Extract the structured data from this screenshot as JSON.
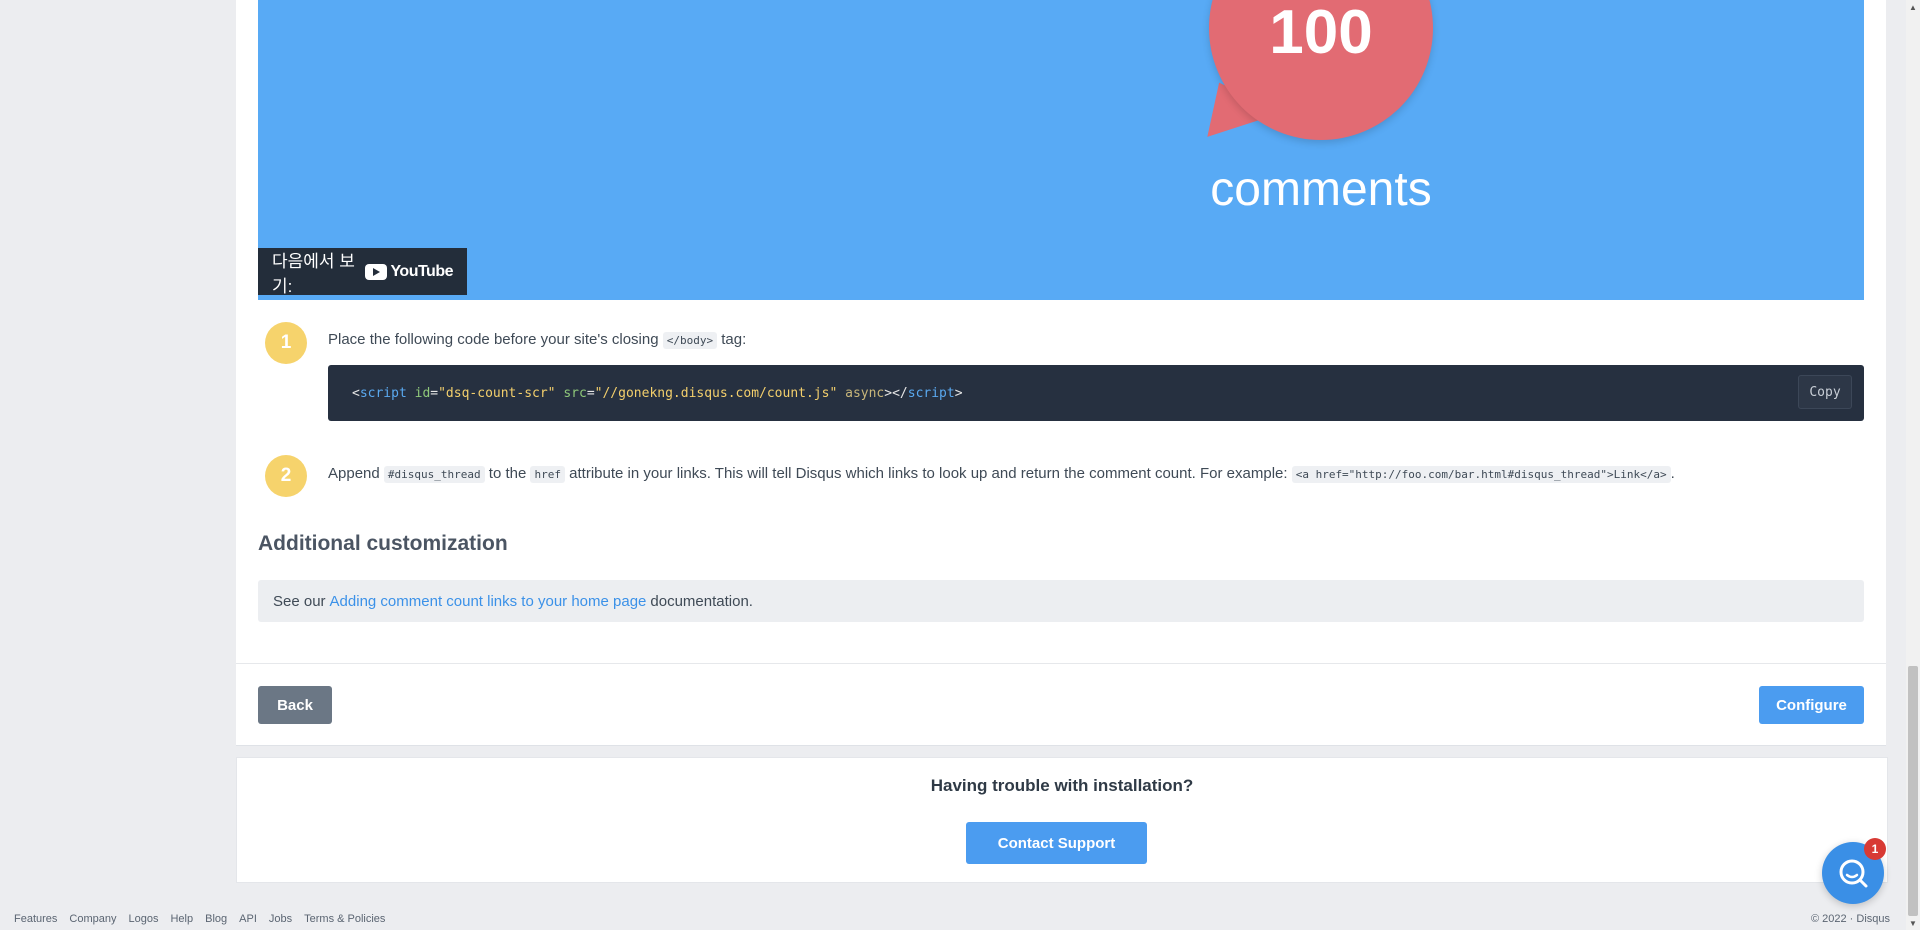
{
  "video": {
    "count": "100",
    "word": "comments",
    "watch_on": "다음에서 보기:",
    "platform": "YouTube"
  },
  "step1": {
    "number": "1",
    "text_before": "Place the following code before your site's closing",
    "code": "</body>",
    "text_after": "tag:"
  },
  "code_snippet": {
    "open_lt": "<",
    "tag": "script",
    "id_attr": "id",
    "id_val": "\"dsq-count-scr\"",
    "src_attr": "src",
    "src_val": "\"//gonekng.disqus.com/count.js\"",
    "async": "async",
    "close": "></",
    "end_tag": "script",
    "end_gt": ">",
    "copy_label": "Copy"
  },
  "step2": {
    "number": "2",
    "append": "Append",
    "code1": "#disqus_thread",
    "to_the": "to the",
    "code2": "href",
    "text": "attribute in your links. This will tell Disqus which links to look up and return the comment count. For example:",
    "code3": "<a href=\"http://foo.com/bar.html#disqus_thread\">Link</a>",
    "period": "."
  },
  "customization": {
    "title": "Additional customization",
    "see_our": "See our",
    "link": "Adding comment count links to your home page",
    "doc": "documentation."
  },
  "buttons": {
    "back": "Back",
    "configure": "Configure"
  },
  "support": {
    "title": "Having trouble with installation?",
    "contact": "Contact Support"
  },
  "footer": {
    "links": [
      "Features",
      "Company",
      "Logos",
      "Help",
      "Blog",
      "API",
      "Jobs",
      "Terms & Policies"
    ],
    "copyright": "© 2022 · Disqus"
  },
  "chat": {
    "badge": "1"
  }
}
